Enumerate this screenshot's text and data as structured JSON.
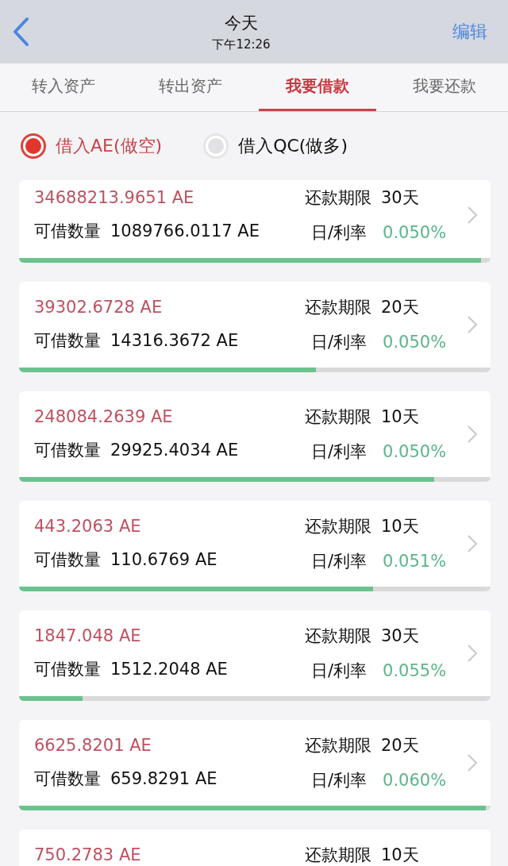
{
  "nav": {
    "title": "今天",
    "subtitle": "下午12:26",
    "action": "编辑"
  },
  "tabs": [
    {
      "label": "转入资产",
      "selected": false
    },
    {
      "label": "转出资产",
      "selected": false
    },
    {
      "label": "我要借款",
      "selected": true
    },
    {
      "label": "我要还款",
      "selected": false
    }
  ],
  "options": [
    {
      "label": "借入AE(做空)",
      "selected": true
    },
    {
      "label": "借入QC(做多)",
      "selected": false
    }
  ],
  "loans": [
    {
      "amount": "34688213.9651 AE",
      "available_label": "可借数量",
      "available": "1089766.0117 AE",
      "term_label": "还款期限",
      "term": "30天",
      "rate_label": "日/利率",
      "rate": "0.050%",
      "level": 0.98
    },
    {
      "amount": "39302.6728 AE",
      "available_label": "可借数量",
      "available": "14316.3672 AE",
      "term_label": "还款期限",
      "term": "20天",
      "rate_label": "日/利率",
      "rate": "0.050%",
      "level": 0.63
    },
    {
      "amount": "248084.2639 AE",
      "available_label": "可借数量",
      "available": "29925.4034 AE",
      "term_label": "还款期限",
      "term": "10天",
      "rate_label": "日/利率",
      "rate": "0.050%",
      "level": 0.88
    },
    {
      "amount": "443.2063 AE",
      "available_label": "可借数量",
      "available": "110.6769 AE",
      "term_label": "还款期限",
      "term": "10天",
      "rate_label": "日/利率",
      "rate": "0.051%",
      "level": 0.75
    },
    {
      "amount": "1847.048 AE",
      "available_label": "可借数量",
      "available": "1512.2048 AE",
      "term_label": "还款期限",
      "term": "30天",
      "rate_label": "日/利率",
      "rate": "0.055%",
      "level": 0.135
    },
    {
      "amount": "6625.8201 AE",
      "available_label": "可借数量",
      "available": "659.8291 AE",
      "term_label": "还款期限",
      "term": "20天",
      "rate_label": "日/利率",
      "rate": "0.060%",
      "level": 0.99
    },
    {
      "amount": "750.2783 AE",
      "term_label": "还款期限",
      "term": "10天"
    }
  ]
}
